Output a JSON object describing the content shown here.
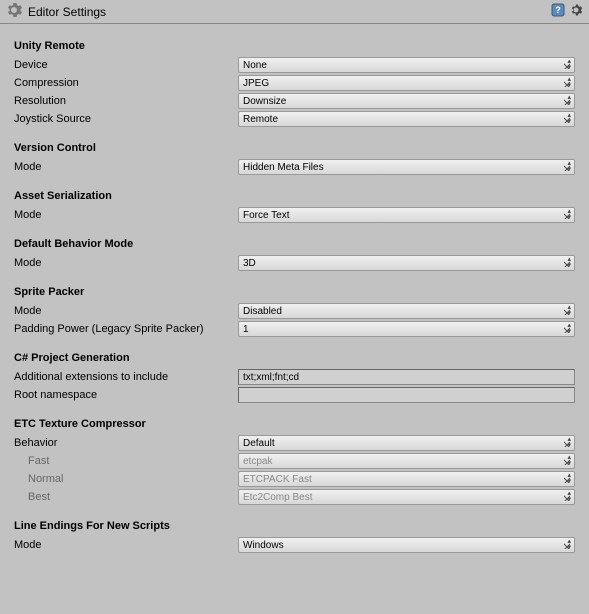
{
  "header": {
    "title": "Editor Settings"
  },
  "sections": {
    "unityRemote": {
      "title": "Unity Remote",
      "device": {
        "label": "Device",
        "value": "None"
      },
      "compression": {
        "label": "Compression",
        "value": "JPEG"
      },
      "resolution": {
        "label": "Resolution",
        "value": "Downsize"
      },
      "joystickSource": {
        "label": "Joystick Source",
        "value": "Remote"
      }
    },
    "versionControl": {
      "title": "Version Control",
      "mode": {
        "label": "Mode",
        "value": "Hidden Meta Files"
      }
    },
    "assetSerialization": {
      "title": "Asset Serialization",
      "mode": {
        "label": "Mode",
        "value": "Force Text"
      }
    },
    "defaultBehaviorMode": {
      "title": "Default Behavior Mode",
      "mode": {
        "label": "Mode",
        "value": "3D"
      }
    },
    "spritePacker": {
      "title": "Sprite Packer",
      "mode": {
        "label": "Mode",
        "value": "Disabled"
      },
      "paddingPower": {
        "label": "Padding Power (Legacy Sprite Packer)",
        "value": "1"
      }
    },
    "csharpProject": {
      "title": "C# Project Generation",
      "additionalExt": {
        "label": "Additional extensions to include",
        "value": "txt;xml;fnt;cd"
      },
      "rootNamespace": {
        "label": "Root namespace",
        "value": ""
      }
    },
    "etcCompressor": {
      "title": "ETC Texture Compressor",
      "behavior": {
        "label": "Behavior",
        "value": "Default"
      },
      "fast": {
        "label": "Fast",
        "value": "etcpak"
      },
      "normal": {
        "label": "Normal",
        "value": "ETCPACK Fast"
      },
      "best": {
        "label": "Best",
        "value": "Etc2Comp Best"
      }
    },
    "lineEndings": {
      "title": "Line Endings For New Scripts",
      "mode": {
        "label": "Mode",
        "value": "Windows"
      }
    }
  }
}
